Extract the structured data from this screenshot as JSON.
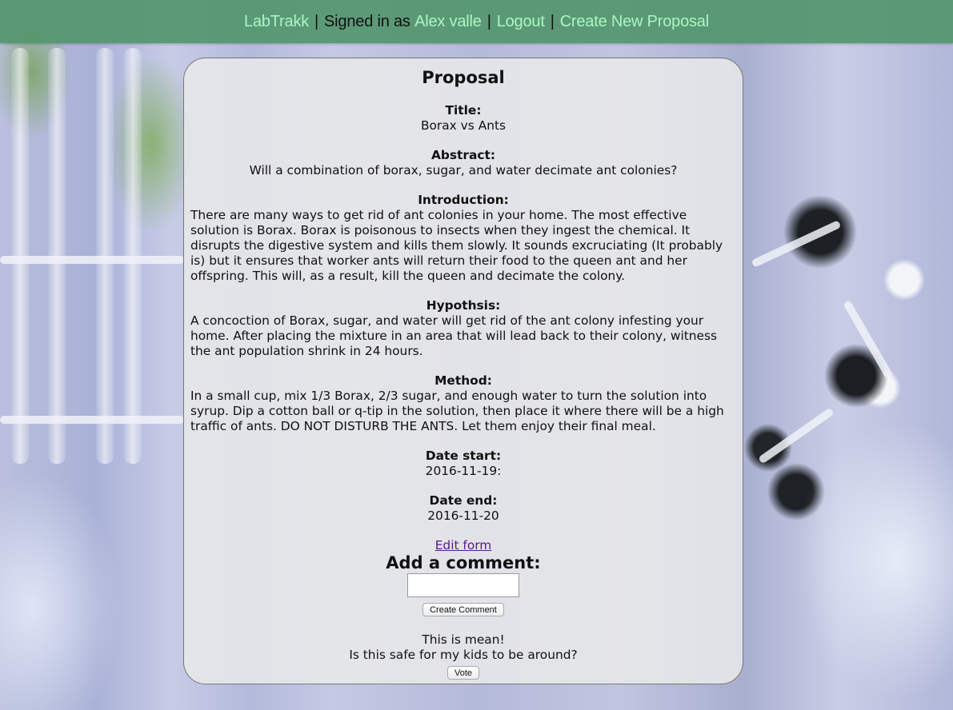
{
  "nav": {
    "app_name": "LabTrakk",
    "signed_in_text": "Signed in as",
    "user_name": "Alex valle",
    "logout": "Logout",
    "create_proposal": "Create New Proposal",
    "separator": "|"
  },
  "proposal": {
    "heading": "Proposal",
    "title_label": "Title:",
    "title": "Borax vs Ants",
    "abstract_label": "Abstract:",
    "abstract": "Will a combination of borax, sugar, and water decimate ant colonies?",
    "introduction_label": "Introduction:",
    "introduction": "There are many ways to get rid of ant colonies in your home. The most effective solution is Borax. Borax is poisonous to insects when they ingest the chemical. It disrupts the digestive system and kills them slowly. It sounds excruciating (It probably is) but it ensures that worker ants will return their food to the queen ant and her offspring. This will, as a result, kill the queen and decimate the colony.",
    "hypothesis_label": "Hypothsis:",
    "hypothesis": "A concoction of Borax, sugar, and water will get rid of the ant colony infesting your home. After placing the mixture in an area that will lead back to their colony, witness the ant population shrink in 24 hours.",
    "method_label": "Method:",
    "method": "In a small cup, mix 1/3 Borax, 2/3 sugar, and enough water to turn the solution into syrup. Dip a cotton ball or q-tip in the solution, then place it where there will be a high traffic of ants. DO NOT DISTURB THE ANTS. Let them enjoy their final meal.",
    "date_start_label": "Date start:",
    "date_start": "2016-11-19:",
    "date_end_label": "Date end:",
    "date_end": "2016-11-20",
    "edit_link": "Edit form"
  },
  "comment_form": {
    "heading": "Add a comment:",
    "input_value": "",
    "submit_label": "Create Comment"
  },
  "comments": [
    "This is mean!",
    "Is this safe for my kids to be around?"
  ],
  "vote_label": "Vote",
  "colors": {
    "nav_bar": "#52966c",
    "nav_link": "#aaf5c4",
    "visited_link": "#551a8b"
  }
}
